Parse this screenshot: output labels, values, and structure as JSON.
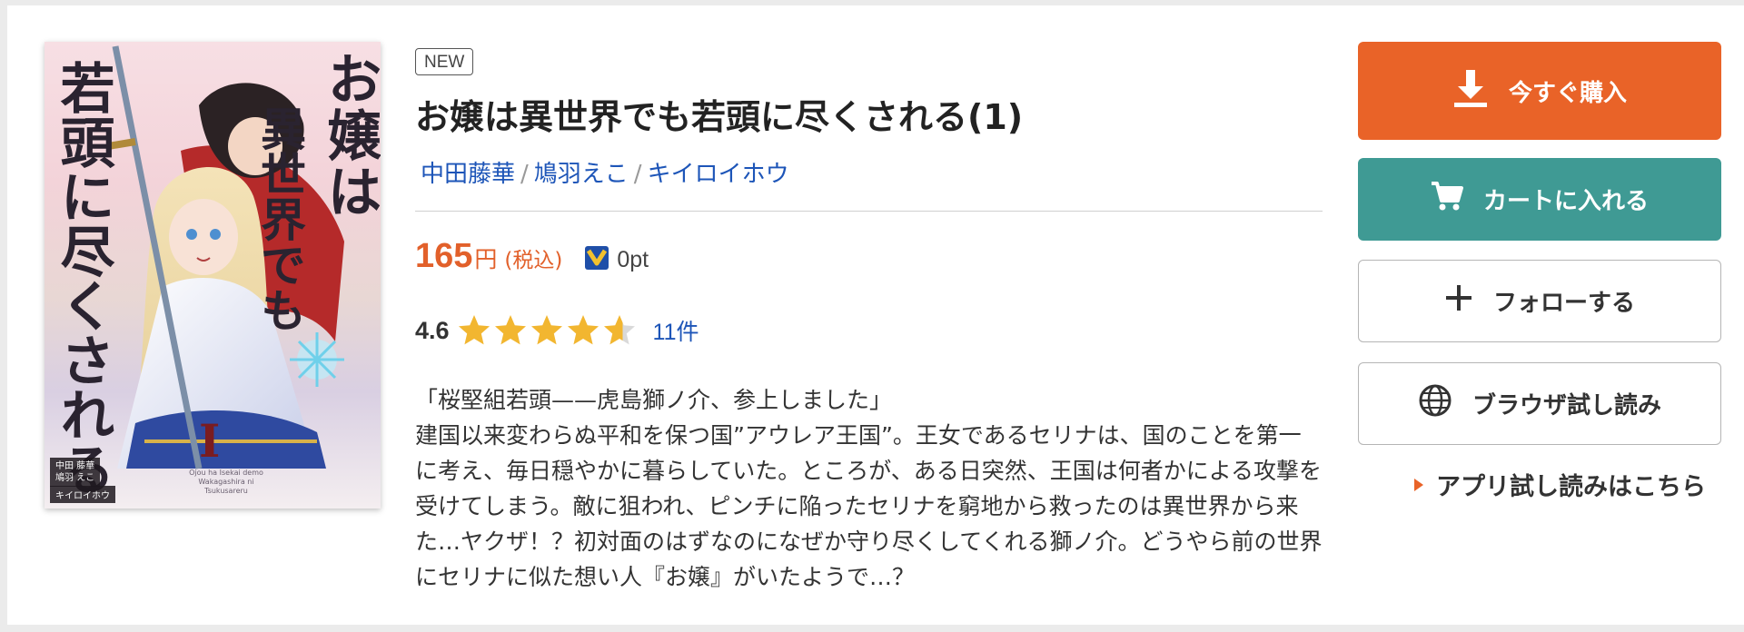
{
  "product": {
    "badge": "NEW",
    "title": "お嬢は異世界でも若頭に尽くされる(1)",
    "authors": [
      "中田藤華",
      "鳩羽えこ",
      "キイロイホウ"
    ],
    "author_separator": "/",
    "price": {
      "value": "165",
      "unit": "円",
      "tax_label": "(税込)",
      "points": "0pt"
    },
    "rating": {
      "score": "4.6",
      "stars": 4.6,
      "count": "11件"
    },
    "description": [
      "「桜堅組若頭——虎島獅ノ介、参上しました」",
      "建国以来変わらぬ平和を保つ国”アウレア王国”。王女であるセリナは、国のことを第一に考え、毎日穏やかに暮らしていた。ところが、ある日突然、王国は何者かによる攻撃を受けてしまう。敵に狙われ、ピンチに陥ったセリナを窮地から救ったのは異世界から来た…ヤクザ！？初対面のはずなのになぜか守り尽くしてくれる獅ノ介。どうやら前の世界にセリナに似た想い人『お嬢』がいたようで…？"
    ]
  },
  "cover": {
    "title_parts": [
      "お嬢は",
      "異世界でも",
      "若頭に尽くされる"
    ],
    "volume": "I",
    "credits": [
      "中田 藤華",
      "鳩羽 えこ"
    ],
    "credit_bottom": "キイロイホウ",
    "subtitle": "Ojou ha Isekai demo Wakagashira ni Tsukusareru"
  },
  "actions": {
    "buy": "今すぐ購入",
    "cart": "カートに入れる",
    "follow": "フォローする",
    "browser_preview": "ブラウザ試し読み",
    "app_preview": "アプリ試し読みはこちら"
  },
  "colors": {
    "accent_orange": "#e96328",
    "cart_teal": "#3f9a94",
    "link_blue": "#1d55b8",
    "star_gold": "#f2b630"
  },
  "icons": {
    "buy": "download-icon",
    "cart": "cart-icon",
    "follow": "plus-icon",
    "browser": "globe-icon",
    "points": "point-badge-icon"
  }
}
